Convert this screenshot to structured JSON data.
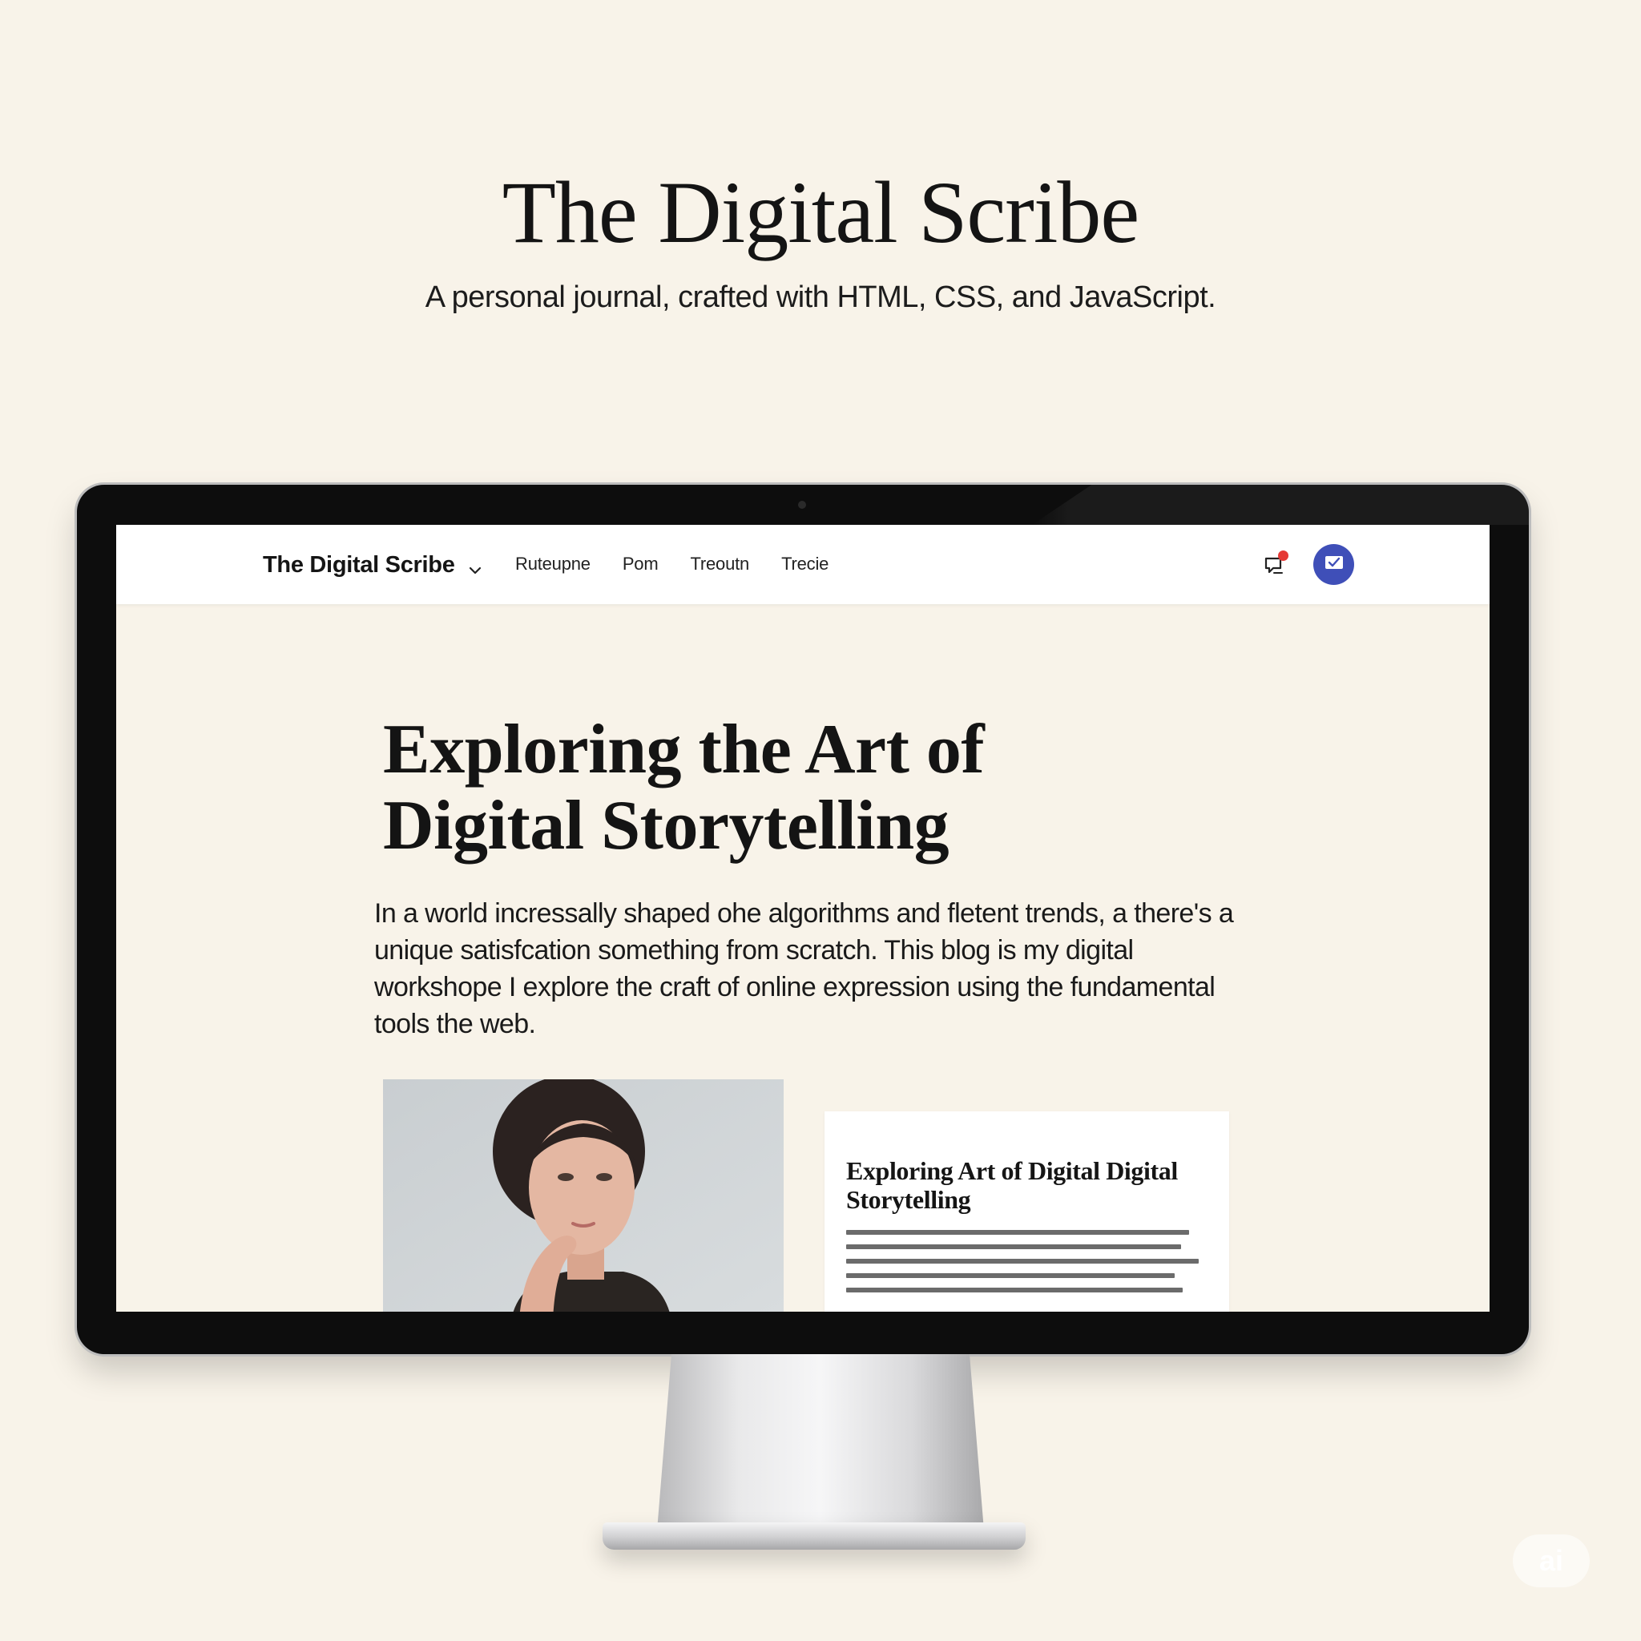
{
  "page": {
    "title": "The Digital Scribe",
    "subtitle": "A personal journal, crafted with HTML, CSS, and JavaScript."
  },
  "site": {
    "nav": {
      "brand": "The Digital Scribe",
      "links": [
        "Ruteupne",
        "Pom",
        "Treoutn",
        "Trecie"
      ],
      "notification_icon": "notification-bell-icon",
      "profile_icon": "mail-check-icon",
      "accent_color": "#3f4fb8",
      "alert_color": "#e53935"
    },
    "article": {
      "title": "Exploring the Art of Digital Storytelling",
      "lede": "In a world incressally shaped ohe algorithms and fletent trends, a there's a unique satisfcation something from scratch. This blog is my digital workshope I explore the craft of online expression using the fundamental tools the web."
    },
    "card": {
      "title": "Exploring Art of Digital Digital Storytelling"
    }
  },
  "watermark": "ai"
}
